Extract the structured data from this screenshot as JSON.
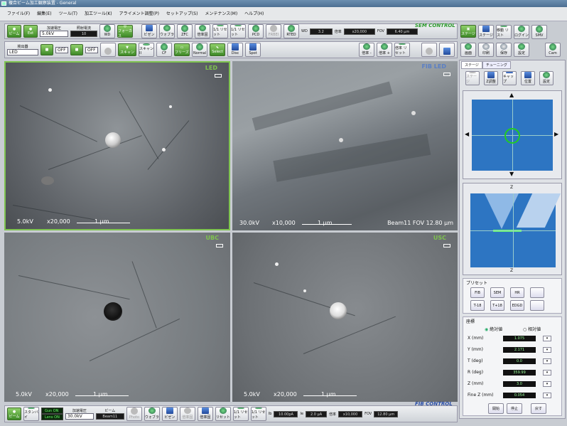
{
  "window": {
    "title": "複合ビーム加工観察装置 - General"
  },
  "menu": [
    "ファイル(F)",
    "編集(E)",
    "ツール(T)",
    "加工ツール(K)",
    "アライメント調整(P)",
    "セットアップ(S)",
    "メンテナンス(M)",
    "ヘルプ(H)"
  ],
  "sem_bar": {
    "beam_label": "ビーム",
    "ext_label": "Ext",
    "accel_label": "加速電圧",
    "accel_value": "5.0kV",
    "irr_label": "照射電流",
    "irr_value": "10",
    "buttons": [
      "WD",
      "フォーカス",
      "ビゼン",
      "ウォブラ",
      "ZFC",
      "倍率固",
      "1/1 リセット",
      "1/1 リセット",
      "PCD",
      "FRBEI",
      "RTED"
    ],
    "wd_label": "WD",
    "wd_value": "3.2",
    "mag_label": "倍率",
    "mag_value": "x20,000",
    "fov_label": "FOV",
    "fov_value": "6.40 μm",
    "title": "SEM CONTROL"
  },
  "det_bar": {
    "det_label": "検出器",
    "det_value": "LED",
    "off1": "OFF",
    "off2": "OFF",
    "buttons": [
      "",
      "スキャン",
      "スキャンII",
      "CF",
      "フリーズ",
      "Normal",
      "Select",
      "Disc",
      "Spot"
    ],
    "mag_minus": "倍率 -",
    "mag_plus": "倍率 +",
    "mag_reset": "倍率 リセット"
  },
  "right_top": [
    "ステージ",
    "ステージ",
    "移動 リスト",
    "ログイン",
    "SMV",
    "画面",
    "印刷",
    "保存",
    "設定",
    "Cam"
  ],
  "panels": [
    {
      "label": "LED",
      "kv": "5.0kV",
      "mag": "x20,000",
      "scale": "1 μm",
      "extra": ""
    },
    {
      "label": "FIB LED",
      "kv": "30.0kV",
      "mag": "x10,000",
      "scale": "1 μm",
      "extra": "Beam11  FOV 12.80 μm"
    },
    {
      "label": "UBC",
      "kv": "5.0kV",
      "mag": "x20,000",
      "scale": "1 μm",
      "extra": ""
    },
    {
      "label": "USC",
      "kv": "5.0kV",
      "mag": "x20,000",
      "scale": "1 μm",
      "extra": ""
    }
  ],
  "rp": {
    "tab1": "ステージ",
    "tab2": "チューニング",
    "tools": [
      "ステージ",
      "Z調整",
      "キャップ",
      "位置",
      "設定"
    ],
    "t_top": "Z",
    "t_bot": "Z",
    "preset_title": "プリセット",
    "preset_btns": [
      "FIB",
      "SEM",
      "HR",
      "",
      "T-18",
      "T+18",
      "EDGD",
      ""
    ],
    "coord_title": "座標",
    "abs": "絶対値",
    "rel": "相対値",
    "rows": [
      {
        "k": "X (mm)",
        "v": "1.075"
      },
      {
        "k": "Y (mm)",
        "v": "2.171"
      },
      {
        "k": "T (deg)",
        "v": "0.0"
      },
      {
        "k": "R (deg)",
        "v": "359.99"
      },
      {
        "k": "Z (mm)",
        "v": "3.0"
      },
      {
        "k": "Fine Z (mm)",
        "v": "0.054"
      }
    ],
    "move": "開始",
    "stop": "停止",
    "back": "戻す"
  },
  "fib_bar": {
    "beam_label": "ビーム",
    "stby_label": "スタンバイ",
    "gun": "Gun  ON",
    "lens": "Lens  ON",
    "accel_label": "加速電圧",
    "accel_value": "30.0kV",
    "beam_name": "Beam11",
    "buttons": [
      "Photo",
      "ウォブラ",
      "ビゼン",
      "倍率固",
      "倍率固",
      "リセット",
      "1/1 リセット",
      "1/1 リセット"
    ],
    "ib_label": "Ib",
    "ib_value": "10.00pA",
    "ie_label": "Ie",
    "ie_value": "2.0 μA",
    "mag_label": "倍率",
    "mag_value": "x10,000",
    "fov_label": "FOV",
    "fov_value": "12.80 μm",
    "title": "FIB CONTROL"
  }
}
